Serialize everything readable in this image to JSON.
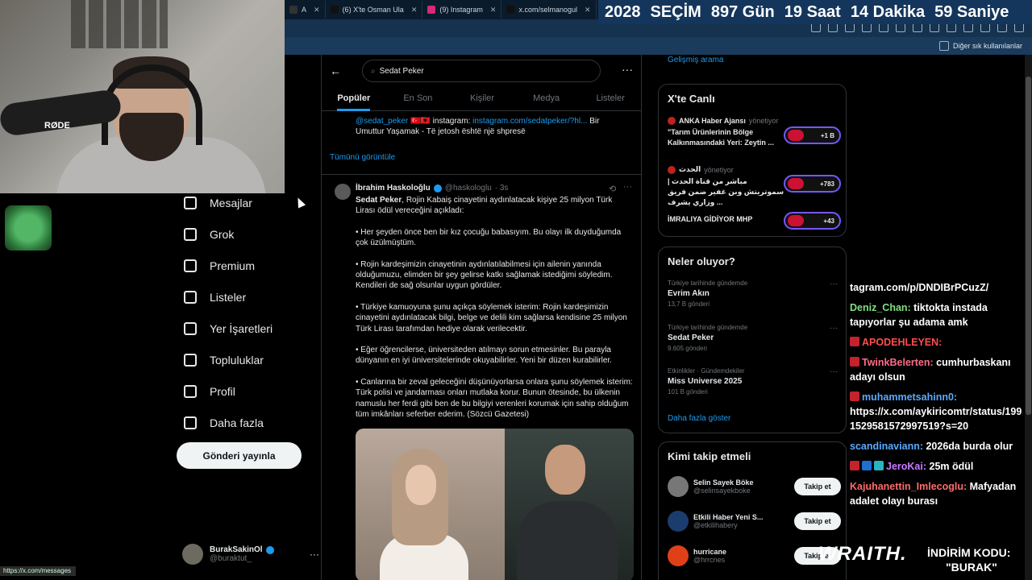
{
  "browser": {
    "tabs": [
      {
        "label": "A",
        "fav": "#333"
      },
      {
        "label": "(6) X'te Osman Ula",
        "fav": "#111"
      },
      {
        "label": "(9) Instagram",
        "fav": "#d62976"
      },
      {
        "label": "x.com/selmanogul",
        "fav": "#111"
      },
      {
        "label": "(9) Ir",
        "fav": "#d62976"
      }
    ],
    "bookmark_folder": "Diğer sık kullanılanlar"
  },
  "countdown": {
    "year": "2028",
    "label": "SEÇİM",
    "days": "897 Gün",
    "hours": "19 Saat",
    "minutes": "14 Dakika",
    "seconds": "59 Saniye"
  },
  "webcam": {
    "mic_brand": "RØDE"
  },
  "nav": {
    "items": [
      {
        "label": "Mesajlar",
        "icon": "mail-icon"
      },
      {
        "label": "Grok",
        "icon": "grok-icon"
      },
      {
        "label": "Premium",
        "icon": "x-logo-icon"
      },
      {
        "label": "Listeler",
        "icon": "list-icon"
      },
      {
        "label": "Yer İşaretleri",
        "icon": "bookmark-icon"
      },
      {
        "label": "Topluluklar",
        "icon": "communities-icon"
      },
      {
        "label": "Profil",
        "icon": "profile-icon"
      },
      {
        "label": "Daha fazla",
        "icon": "more-circle-icon"
      }
    ],
    "post_button": "Gönderi yayınla",
    "user": {
      "name": "BurakSakinOl",
      "handle": "@buraktut_"
    },
    "status_url": "https://x.com/messages"
  },
  "search": {
    "query": "Sedat Peker",
    "tabs": [
      "Popüler",
      "En Son",
      "Kişiler",
      "Medya",
      "Listeler"
    ],
    "active_tab": "Popüler"
  },
  "prev_post": {
    "handle": "@sedat_peker",
    "text_a": "instagram: ",
    "link": "instagram.com/sedatpeker/?hl...",
    "text_b": " Bir Umuttur Yaşamak - Të jetosh është një shpresë",
    "show_all": "Tümünü görüntüle"
  },
  "tweet": {
    "author": "İbrahim Haskoloğlu",
    "handle": "@haskologlu",
    "time": "· 3s",
    "lead_bold": "Sedat Peker",
    "lead_rest": ", Rojin Kabaiş cinayetini aydınlatacak kişiye 25 milyon Türk Lirası ödül vereceğini açıkladı:",
    "p1": "• Her şeyden önce ben bir kız çocuğu babasıyım. Bu olayı ilk duyduğumda çok üzülmüştüm.",
    "p2": "• Rojin kardeşimizin cinayetinin aydınlatılabilmesi için ailenin yanında olduğumuzu, elimden bir şey gelirse katkı sağlamak istediğimi söyledim. Kendileri de sağ olsunlar uygun gördüler.",
    "p3": "• Türkiye kamuoyuna şunu açıkça söylemek isterim: Rojin kardeşimizin cinayetini aydınlatacak bilgi, belge ve delili kim sağlarsa kendisine 25 milyon Türk Lirası tarafımdan hediye olarak verilecektir.",
    "p4": "• Eğer öğrencilerse, üniversiteden atılmayı sorun etmesinler. Bu parayla dünyanın en iyi üniversitelerinde okuyabilirler. Yeni bir düzen kurabilirler.",
    "p5": "• Canlarına bir zeval geleceğini düşünüyorlarsa onlara şunu söylemek isterim: Türk polisi ve jandarması onları mutlaka korur. Bunun ötesinde, bu ülkenin namuslu her ferdi gibi ben de bu bilgiyi verenleri korumak için sahip olduğum tüm imkânları seferber ederim. (Sözcü Gazetesi)"
  },
  "right": {
    "advanced_search": "Gelişmiş arama",
    "live_title": "X'te Canlı",
    "live": [
      {
        "source": "ANKA Haber Ajansı",
        "role": "yönetiyor",
        "text": "\"Tarım Ürünlerinin Bölge Kalkınmasındaki Yeri: Zeytin ...",
        "count": "+1 B"
      },
      {
        "source": "الحدث",
        "role": "yönetiyor",
        "text": "مباشر من قناة الحدث | سموتريتش وبن غفير ضمن فريق وزاري يشرف ...",
        "count": "+783"
      },
      {
        "source": "",
        "role": "",
        "text": "İMRALIYA GİDİYOR MHP",
        "count": "+43"
      }
    ],
    "trends_title": "Neler oluyor?",
    "trends": [
      {
        "category": "Türkiye tarihinde gündemde",
        "name": "Evrim Akın",
        "count": "13,7 B gönderi"
      },
      {
        "category": "Türkiye tarihinde gündemde",
        "name": "Sedat Peker",
        "count": "9.605 gönderi"
      },
      {
        "category": "Etkinlikler · Gündemdekiler",
        "name": "Miss Universe 2025",
        "count": "101 B gönderi"
      }
    ],
    "show_more": "Daha fazla göster",
    "follow_title": "Kimi takip etmeli",
    "follow": [
      {
        "name": "Selin Sayek Böke",
        "handle": "@selinsayekboke",
        "button": "Takip et",
        "color": "#777"
      },
      {
        "name": "Etkili Haber Yeni S...",
        "handle": "@etkilihabery",
        "button": "Takip et",
        "color": "#1b3d6e"
      },
      {
        "name": "hurricane",
        "handle": "@hrrcnes",
        "button": "Takip et",
        "color": "#e04018"
      }
    ]
  },
  "chat": {
    "messages": [
      {
        "user": "",
        "user_color": "#fff",
        "text": "tagram.com/p/DNDIBrPCuzZ/",
        "badges": []
      },
      {
        "user": "Deniz_Chan:",
        "user_color": "#7fe07f",
        "text": " tiktokta instada tapıyorlar şu adama amk",
        "badges": []
      },
      {
        "user": "APODEHLEYEN:",
        "user_color": "#ff4d4d",
        "text": "",
        "badges": [
          "r"
        ]
      },
      {
        "user": "TwinkBelerten:",
        "user_color": "#ff6b8a",
        "text": " cumhurbaskanı adayı olsun",
        "badges": [
          "r"
        ]
      },
      {
        "user": "muhammetsahinn0:",
        "user_color": "#5aa9ff",
        "text": " https://x.com/aykiricomtr/status/1991529581572997519?s=20",
        "badges": [
          "r"
        ]
      },
      {
        "user": "scandinaviann:",
        "user_color": "#5aa9ff",
        "text": " 2026da burda olur",
        "badges": []
      },
      {
        "user": "JeroKai:",
        "user_color": "#c87bff",
        "text": " 25m ödül",
        "badges": [
          "r",
          "b",
          "c"
        ]
      },
      {
        "user": "Kajuhanettin_Imlecoglu:",
        "user_color": "#ff6b6b",
        "text": " Mafyadan adalet olayı burası",
        "badges": []
      }
    ]
  },
  "sponsor": {
    "brand": "WRAITH.",
    "line1": "İNDİRİM KODU:",
    "line2": "\"BURAK\""
  }
}
